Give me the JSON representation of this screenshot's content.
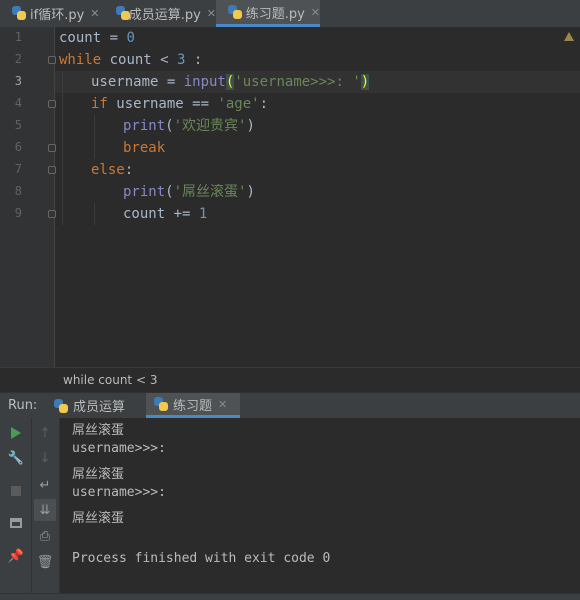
{
  "tabs": [
    {
      "label": "if循环.py",
      "active": false
    },
    {
      "label": "成员运算.py",
      "active": false
    },
    {
      "label": "练习题.py",
      "active": true
    }
  ],
  "editor": {
    "line_numbers": [
      "1",
      "2",
      "3",
      "4",
      "5",
      "6",
      "7",
      "8",
      "9"
    ],
    "line1": {
      "var": "count",
      "op": " = ",
      "num": "0"
    },
    "line2": {
      "kw": "while",
      "rest": " count < ",
      "num": "3",
      "tail": " :"
    },
    "line3": {
      "var": "username = ",
      "fn": "input",
      "open": "(",
      "str": "'username>>>: '",
      "close": ")"
    },
    "line4": {
      "kw": "if",
      "rest": " username == ",
      "str": "'age'",
      "tail": ":"
    },
    "line5": {
      "fn": "print",
      "open": "(",
      "str": "'欢迎贵宾'",
      "close": ")"
    },
    "line6": {
      "kw": "break"
    },
    "line7": {
      "kw": "else",
      "tail": ":"
    },
    "line8": {
      "fn": "print",
      "open": "(",
      "str": "'屌丝滚蛋'",
      "close": ")"
    },
    "line9": {
      "rest": "count += ",
      "num": "1"
    }
  },
  "breadcrumb": "while count < 3",
  "run": {
    "label": "Run:",
    "tabs": [
      {
        "label": "成员运算",
        "active": false
      },
      {
        "label": "练习题",
        "active": true
      }
    ]
  },
  "console": {
    "lines": [
      "屌丝滚蛋",
      "username>>>:",
      "屌丝滚蛋",
      "username>>>:",
      "屌丝滚蛋",
      "",
      "Process finished with exit code 0"
    ]
  },
  "icons": {
    "run": "play-icon",
    "wrench": "wrench-icon",
    "stop": "stop-icon",
    "layout": "layout-icon",
    "pin": "pin-icon",
    "up": "arrow-up-icon",
    "down": "arrow-down-icon",
    "wrap": "soft-wrap-icon",
    "scroll": "scroll-to-end-icon",
    "print": "print-icon",
    "trash": "trash-icon"
  },
  "colors": {
    "accent": "#4a88c7",
    "keyword": "#cc7832",
    "string": "#6a8759",
    "number": "#6897bb",
    "builtin": "#8888c6"
  }
}
